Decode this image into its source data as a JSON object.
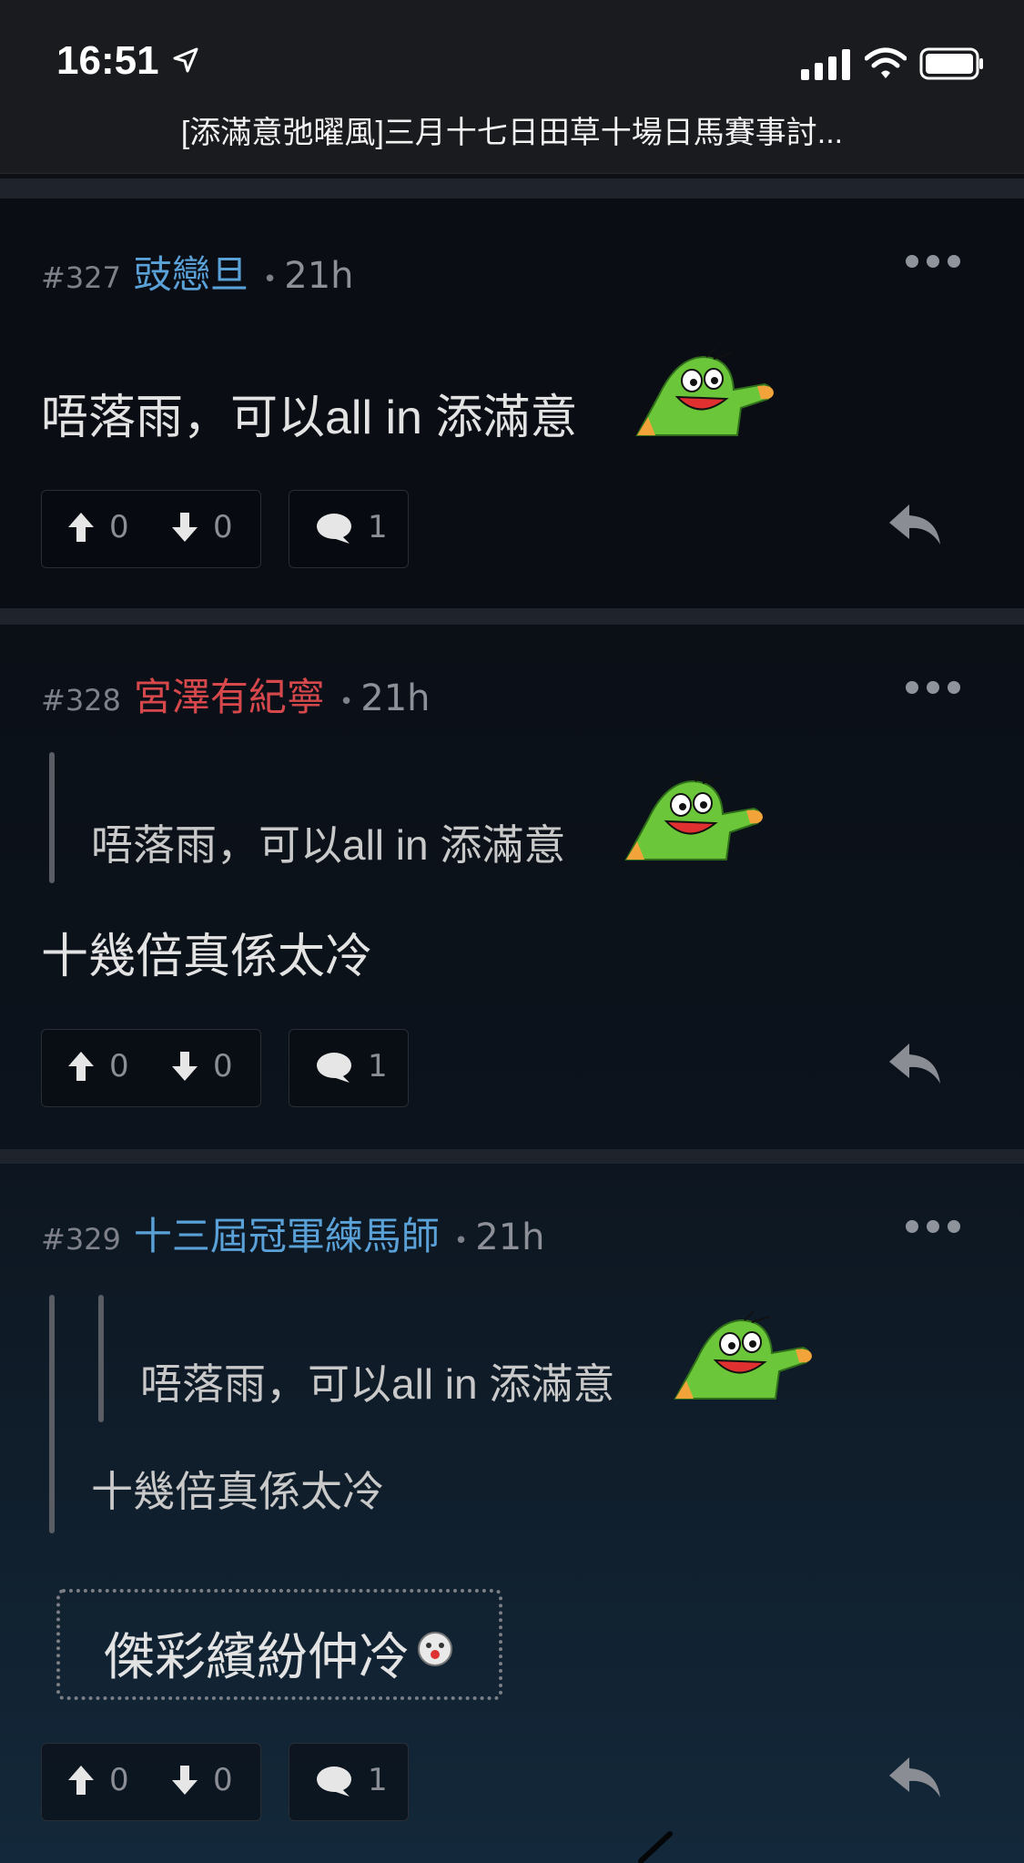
{
  "status_bar": {
    "time": "16:51"
  },
  "thread": {
    "title": "[添滿意弛曜風]三月十七日田草十場日馬賽事討..."
  },
  "posts": [
    {
      "number": "#327",
      "username": "豉戀旦",
      "age": "21h",
      "body": "唔落雨，可以all in 添滿意",
      "upvotes": "0",
      "downvotes": "0",
      "comments": "1"
    },
    {
      "number": "#328",
      "username": "宮澤有紀寧",
      "age": "21h",
      "quote": "唔落雨，可以all in 添滿意",
      "body": "十幾倍真係太冷",
      "upvotes": "0",
      "downvotes": "0",
      "comments": "1"
    },
    {
      "number": "#329",
      "username": "十三屆冠軍練馬師",
      "age": "21h",
      "nested_quote": "唔落雨，可以all in 添滿意",
      "quote": "十幾倍真係太冷",
      "body": "傑彩繽紛仲冷",
      "upvotes": "0",
      "downvotes": "0",
      "comments": "1"
    }
  ],
  "colors": {
    "username_blue": "#5aa1d8",
    "username_red": "#d6484b",
    "background": "#0d0f14"
  },
  "icons": [
    "location-arrow-icon",
    "cellular-signal-icon",
    "wifi-icon",
    "battery-icon",
    "more-icon",
    "upvote-icon",
    "downvote-icon",
    "comment-icon",
    "reply-icon",
    "frog-sticker-icon",
    "smiley-icon"
  ]
}
